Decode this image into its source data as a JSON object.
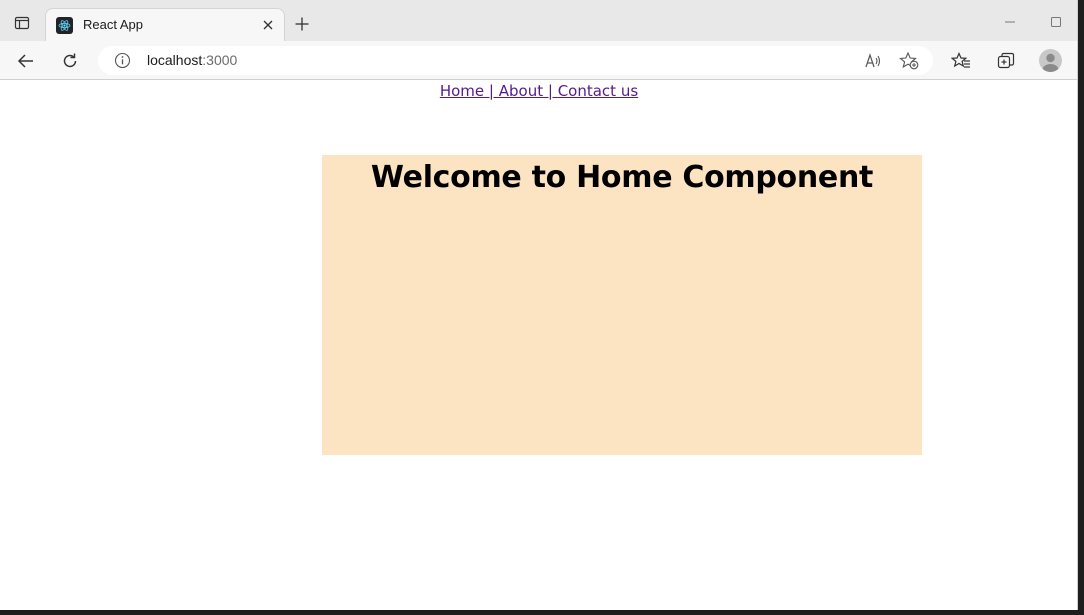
{
  "browser": {
    "tab": {
      "title": "React App",
      "favicon": "react-logo-icon"
    },
    "address_bar": {
      "host": "localhost",
      "port": ":3000"
    },
    "colors": {
      "tabstrip": "#e8e8e8",
      "toolbar": "#f7f7f7"
    }
  },
  "page": {
    "nav": {
      "home": "Home",
      "sep1": " | ",
      "about": "About",
      "sep2": " | ",
      "contact": "Contact us"
    },
    "home": {
      "title": "Welcome to Home Component",
      "background": "#fce4c3"
    },
    "colors": {
      "link": "#551a8b"
    }
  }
}
